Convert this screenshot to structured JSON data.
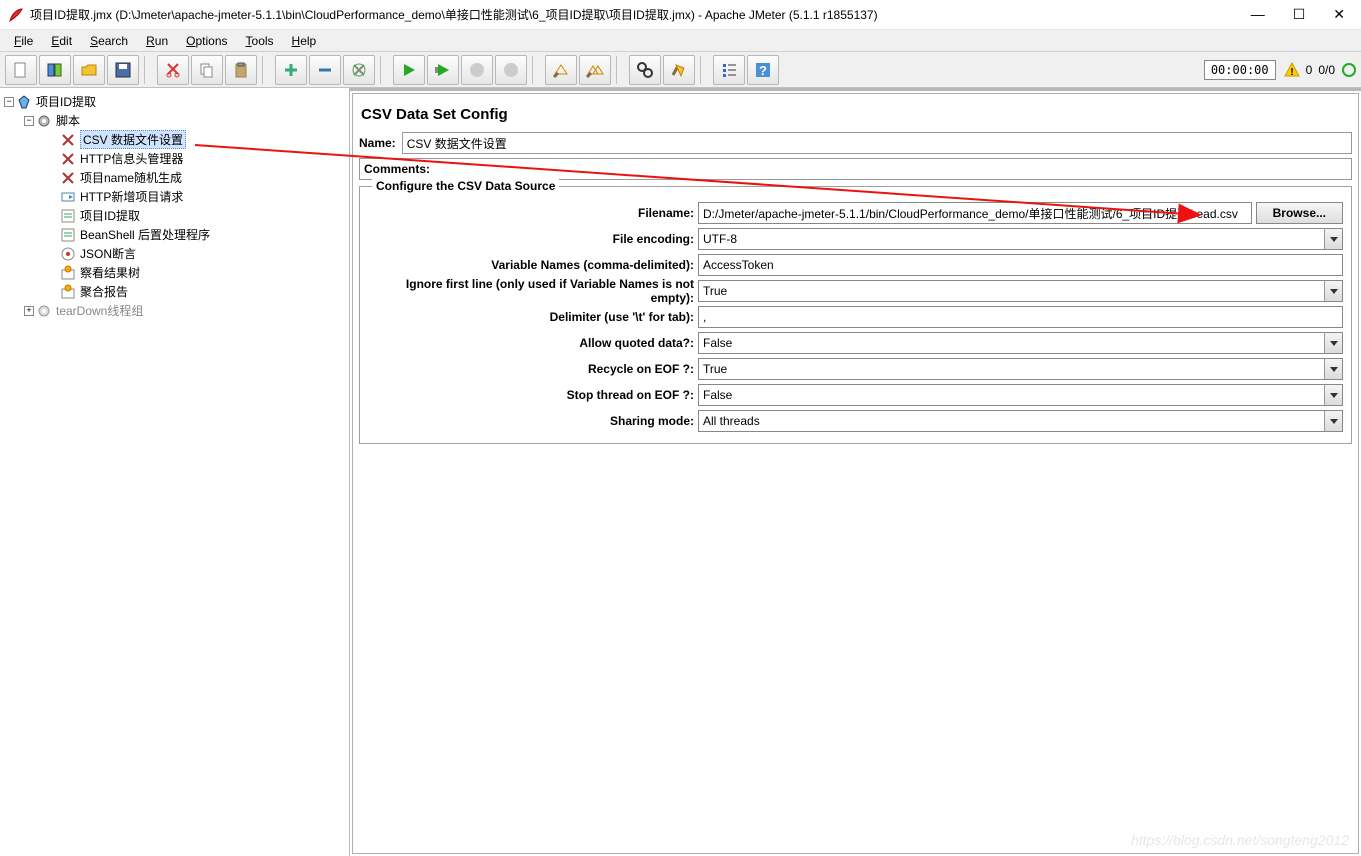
{
  "window": {
    "title": "项目ID提取.jmx (D:\\Jmeter\\apache-jmeter-5.1.1\\bin\\CloudPerformance_demo\\单接口性能测试\\6_项目ID提取\\项目ID提取.jmx) - Apache JMeter (5.1.1 r1855137)"
  },
  "menus": {
    "file": "File",
    "edit": "Edit",
    "search": "Search",
    "run": "Run",
    "options": "Options",
    "tools": "Tools",
    "help": "Help"
  },
  "toolbar": {
    "timer": "00:00:00",
    "warn_count": "0",
    "thread_stat": "0/0"
  },
  "tree": {
    "root": "项目ID提取",
    "thread_group": "脚本",
    "items": [
      "CSV 数据文件设置",
      "HTTP信息头管理器",
      "项目name随机生成",
      "HTTP新增项目请求",
      "项目ID提取",
      "BeanShell 后置处理程序",
      "JSON断言",
      "察看结果树",
      "聚合报告"
    ],
    "teardown": "tearDown线程组"
  },
  "panel": {
    "title": "CSV Data Set Config",
    "name_label": "Name:",
    "name_value": "CSV 数据文件设置",
    "comments_label": "Comments:",
    "fieldset_legend": "Configure the CSV Data Source",
    "browse": "Browse...",
    "rows": {
      "filename_label": "Filename:",
      "filename_value": "D:/Jmeter/apache-jmeter-5.1.1/bin/CloudPerformance_demo/单接口性能测试/6_项目ID提取/read.csv",
      "encoding_label": "File encoding:",
      "encoding_value": "UTF-8",
      "vars_label": "Variable Names (comma-delimited):",
      "vars_value": "AccessToken",
      "ignore_label": "Ignore first line (only used if Variable Names is not empty):",
      "ignore_value": "True",
      "delim_label": "Delimiter (use '\\t' for tab):",
      "delim_value": ",",
      "quoted_label": "Allow quoted data?:",
      "quoted_value": "False",
      "recycle_label": "Recycle on EOF ?:",
      "recycle_value": "True",
      "stop_label": "Stop thread on EOF ?:",
      "stop_value": "False",
      "sharing_label": "Sharing mode:",
      "sharing_value": "All threads"
    }
  },
  "watermark": "https://blog.csdn.net/songteng2012"
}
